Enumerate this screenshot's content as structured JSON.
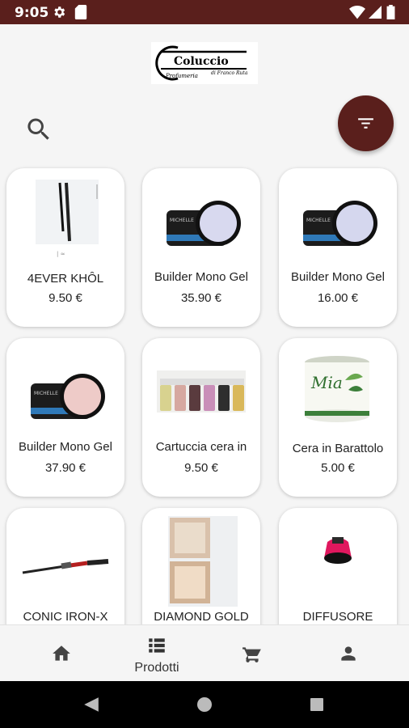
{
  "status_bar": {
    "time": "9:05",
    "icons": [
      "gear-icon",
      "sd-card-icon",
      "wifi-icon",
      "signal-icon",
      "battery-icon"
    ]
  },
  "header": {
    "logo_name": "Coluccio",
    "logo_tagline": "di Franco Ruta",
    "logo_subtitle": "Profumeria"
  },
  "products": [
    {
      "name": "4EVER  KHÔL",
      "price": "9.50 €",
      "image": "eyeliner-pencil"
    },
    {
      "name": "Builder Mono Gel",
      "price": "35.90 €",
      "image": "gel-jar-lilac"
    },
    {
      "name": "Builder Mono Gel",
      "price": "16.00 €",
      "image": "gel-jar-lilac"
    },
    {
      "name": "Builder Mono Gel",
      "price": "37.90 €",
      "image": "gel-jar-pink"
    },
    {
      "name": "Cartuccia cera in",
      "price": "9.50 €",
      "image": "wax-cartridges"
    },
    {
      "name": "Cera in Barattolo",
      "price": "5.00 €",
      "image": "wax-jar"
    },
    {
      "name": "CONIC IRON-X",
      "price": "",
      "image": "curling-iron"
    },
    {
      "name": "DIAMOND GOLD",
      "price": "",
      "image": "compact-powder"
    },
    {
      "name": "DIFFUSORE",
      "price": "",
      "image": "hair-diffuser"
    }
  ],
  "bottom_nav": [
    {
      "icon": "home-icon",
      "label": ""
    },
    {
      "icon": "list-icon",
      "label": "Prodotti"
    },
    {
      "icon": "cart-icon",
      "label": ""
    },
    {
      "icon": "person-icon",
      "label": ""
    }
  ],
  "colors": {
    "brand": "#5a1f1c",
    "background": "#f5f5f5",
    "card": "#ffffff"
  }
}
